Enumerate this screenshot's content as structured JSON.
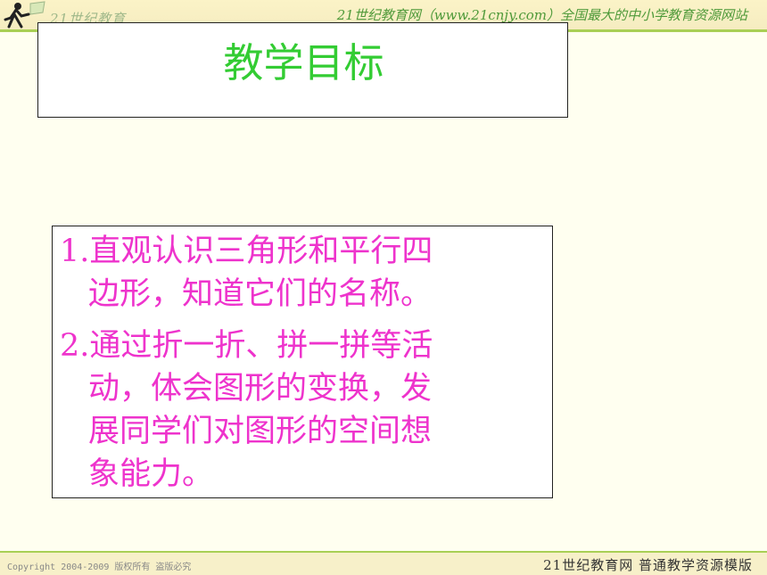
{
  "header": {
    "logo_text": "21世纪教育",
    "slogan": "21世纪教育网（www.21cnjy.com）全国最大的中小学教育资源网站"
  },
  "slide": {
    "title": "教学目标",
    "items": [
      {
        "line1": "1.直观认识三角形和平行四",
        "line2": "边形，知道它们的名称。"
      },
      {
        "line1": "2.通过折一折、拼一拼等活",
        "line2": "动，体会图形的变换，发",
        "line3": "展同学们对图形的空间想",
        "line4": "象能力。"
      }
    ]
  },
  "footer": {
    "copyright": "Copyright 2004-2009 版权所有 盗版必究",
    "right_text": "21世纪教育网   普通教学资源模版"
  },
  "colors": {
    "title": "#33cc33",
    "content": "#ee33cc",
    "accent_line": "#a9cf55"
  }
}
